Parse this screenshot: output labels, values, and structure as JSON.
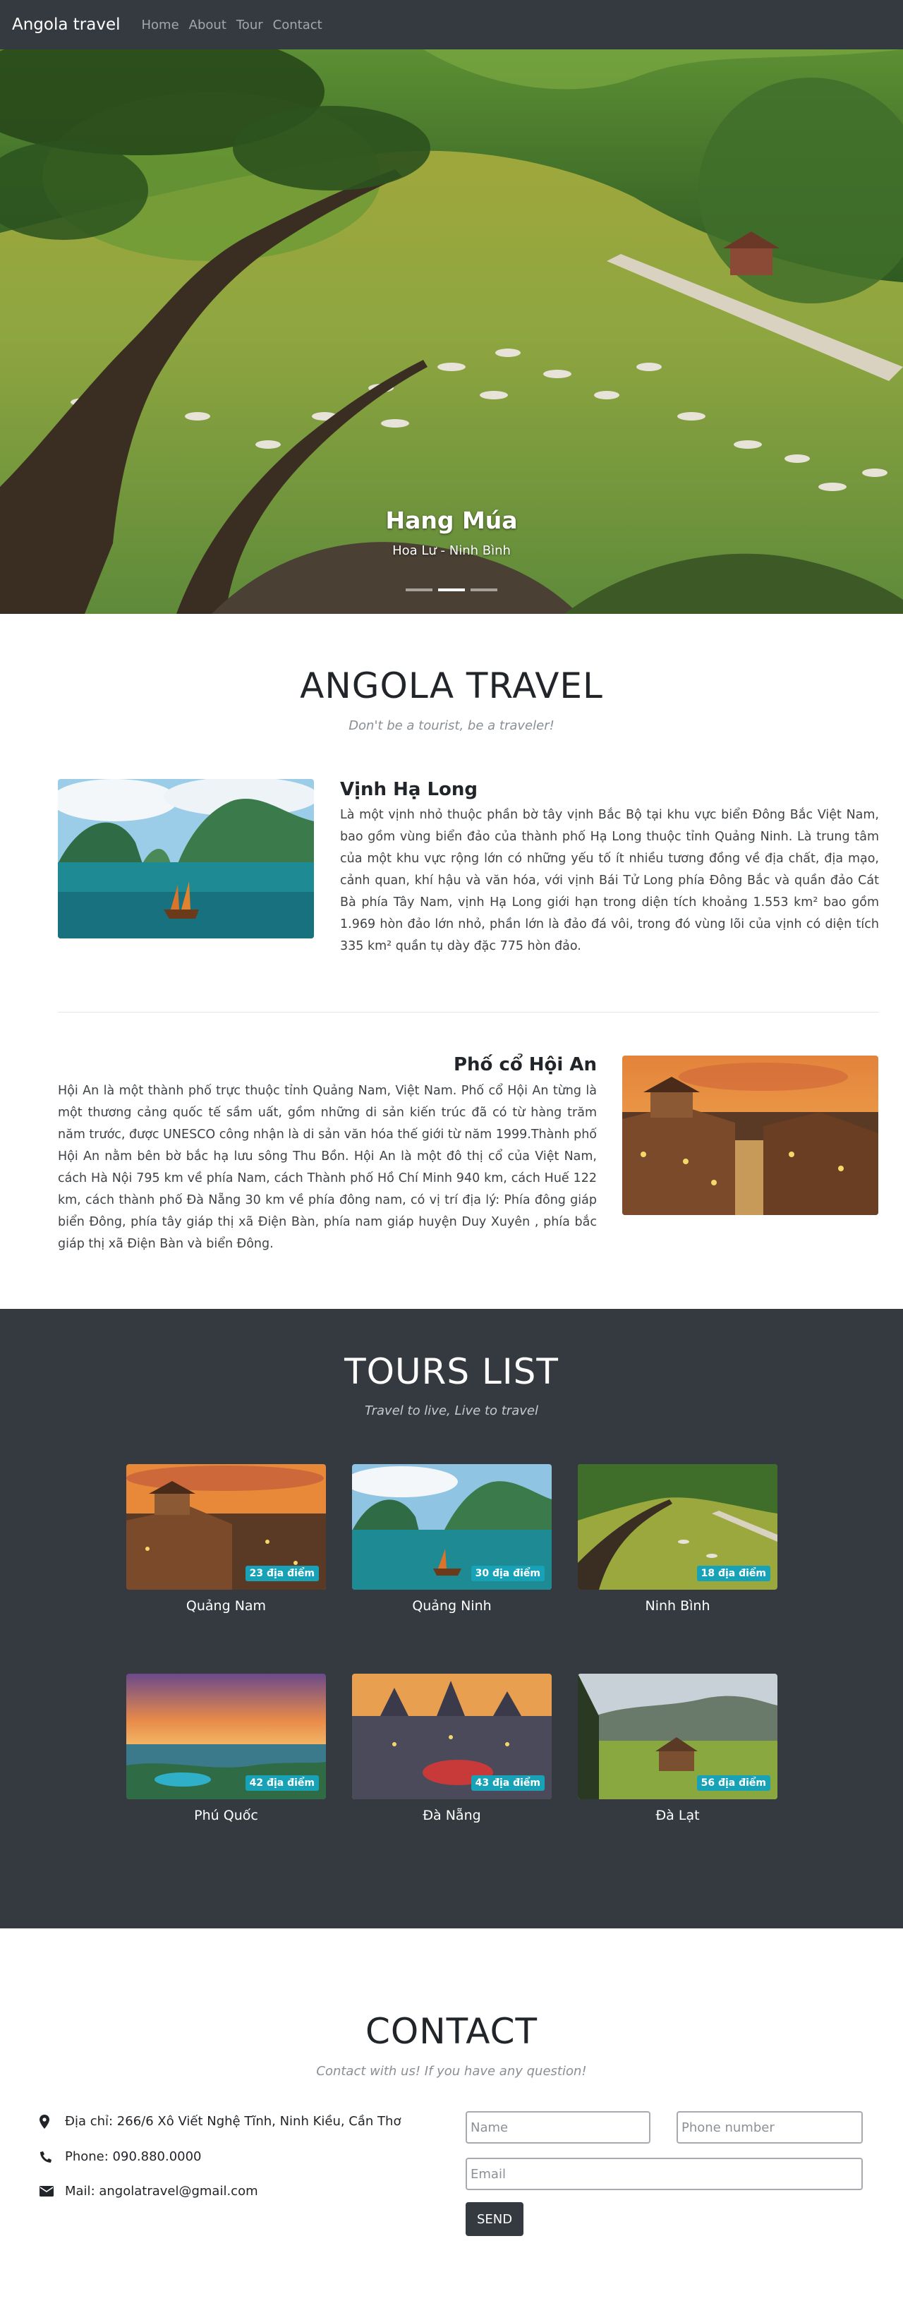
{
  "navbar": {
    "brand": "Angola travel",
    "links": [
      "Home",
      "About",
      "Tour",
      "Contact"
    ]
  },
  "hero": {
    "title": "Hang Múa",
    "subtitle": "Hoa Lư - Ninh Bình",
    "slide_count": 3,
    "active_slide": 1
  },
  "about": {
    "title": "ANGOLA TRAVEL",
    "subtitle": "Don't be a tourist, be a traveler!",
    "features": [
      {
        "title": "Vịnh Hạ Long",
        "text": "Là một vịnh nhỏ thuộc phần bờ tây vịnh Bắc Bộ tại khu vực biển Đông Bắc Việt Nam, bao gồm vùng biển đảo của thành phố Hạ Long thuộc tỉnh Quảng Ninh. Là trung tâm của một khu vực rộng lớn có những yếu tố ít nhiều tương đồng về địa chất, địa mạo, cảnh quan, khí hậu và văn hóa, với vịnh Bái Tử Long phía Đông Bắc và quần đảo Cát Bà phía Tây Nam, vịnh Hạ Long giới hạn trong diện tích khoảng 1.553 km² bao gồm 1.969 hòn đảo lớn nhỏ, phần lớn là đảo đá vôi, trong đó vùng lõi của vịnh có diện tích 335 km² quần tụ dày đặc 775 hòn đảo."
      },
      {
        "title": "Phố cổ Hội An",
        "text": "Hội An là một thành phố trực thuộc tỉnh Quảng Nam, Việt Nam. Phố cổ Hội An từng là một thương cảng quốc tế sầm uất, gồm những di sản kiến trúc đã có từ hàng trăm năm trước, được UNESCO công nhận là di sản văn hóa thế giới từ năm 1999.Thành phố Hội An nằm bên bờ bắc hạ lưu sông Thu Bồn. Hội An là một đô thị cổ của Việt Nam, cách Hà Nội 795 km về phía Nam, cách Thành phố Hồ Chí Minh 940 km, cách Huế 122 km, cách thành phố Đà Nẵng 30 km về phía đông nam, có vị trí địa lý: Phía đông giáp biển Đông, phía tây giáp thị xã Điện Bàn, phía nam giáp huyện Duy Xuyên , phía bắc giáp thị xã Điện Bàn và biển Đông."
      }
    ]
  },
  "tours": {
    "title": "TOURS LIST",
    "subtitle": "Travel to live, Live to travel",
    "items": [
      {
        "name": "Quảng Nam",
        "badge": "23 địa điểm",
        "scene": "old-town-sunset"
      },
      {
        "name": "Quảng Ninh",
        "badge": "30 địa điểm",
        "scene": "bay-karst"
      },
      {
        "name": "Ninh Bình",
        "badge": "18 địa điểm",
        "scene": "river-valley"
      },
      {
        "name": "Phú Quốc",
        "badge": "42 địa điểm",
        "scene": "beach-sunset"
      },
      {
        "name": "Đà Nẵng",
        "badge": "43 địa điểm",
        "scene": "castle-night"
      },
      {
        "name": "Đà Lạt",
        "badge": "56 địa điểm",
        "scene": "meadow-cabin"
      }
    ]
  },
  "contact": {
    "title": "CONTACT",
    "subtitle": "Contact with us! If you have any question!",
    "address": "Địa chỉ: 266/6 Xô Viết Nghệ Tĩnh, Ninh Kiều, Cần Thơ",
    "phone": "Phone: 090.880.0000",
    "mail": "Mail: angolatravel@gmail.com",
    "form": {
      "name_placeholder": "Name",
      "phone_placeholder": "Phone number",
      "email_placeholder": "Email",
      "send_label": "SEND"
    }
  },
  "colors": {
    "dark": "#343a40",
    "badge": "#17a2b8"
  }
}
